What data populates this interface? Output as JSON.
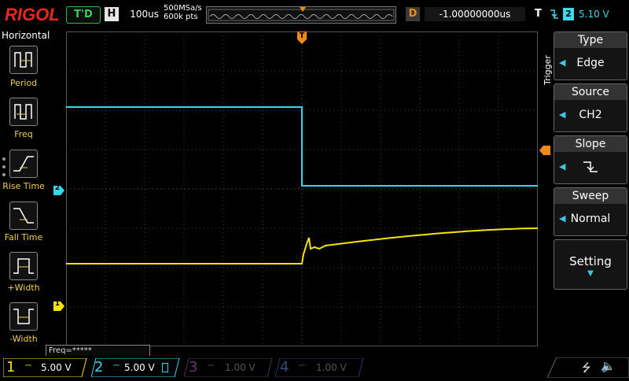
{
  "brand": "RIGOL",
  "top": {
    "run_status": "T'D",
    "h_label": "H",
    "timebase": "100us",
    "sample_rate": "500MSa/s",
    "mem_depth": "600k pts",
    "delay_label": "D",
    "delay": "-1.00000000us",
    "trig_label": "T",
    "trig_channel": "2",
    "trig_level": "5.10 V"
  },
  "left_menu": {
    "title": "Horizontal",
    "items": [
      {
        "label": "Period"
      },
      {
        "label": "Freq"
      },
      {
        "label": "Rise Time"
      },
      {
        "label": "Fall Time"
      },
      {
        "label": "+Width"
      },
      {
        "label": "-Width"
      }
    ]
  },
  "right_menu": {
    "tab": "Trigger",
    "type_title": "Type",
    "type_value": "Edge",
    "source_title": "Source",
    "source_value": "CH2",
    "slope_title": "Slope",
    "sweep_title": "Sweep",
    "sweep_value": "Normal",
    "setting_label": "Setting"
  },
  "freq_readout": "Freq=*****",
  "channels": [
    {
      "num": "1",
      "scale": "5.00 V",
      "color": "#f5e400",
      "active": true
    },
    {
      "num": "2",
      "scale": "5.00 V",
      "color": "#35d8e8",
      "active": true
    },
    {
      "num": "3",
      "scale": "1.00 V",
      "color": "#d040b0",
      "active": false
    },
    {
      "num": "4",
      "scale": "1.00 V",
      "color": "#3a6ad8",
      "active": false
    }
  ],
  "markers": {
    "ch1": "1",
    "ch2": "2",
    "trigger_top": "T"
  },
  "colors": {
    "ch1": "#f5e400",
    "ch2": "#35d8e8",
    "trigger": "#f08a18",
    "grid": "#3c3c3c"
  }
}
